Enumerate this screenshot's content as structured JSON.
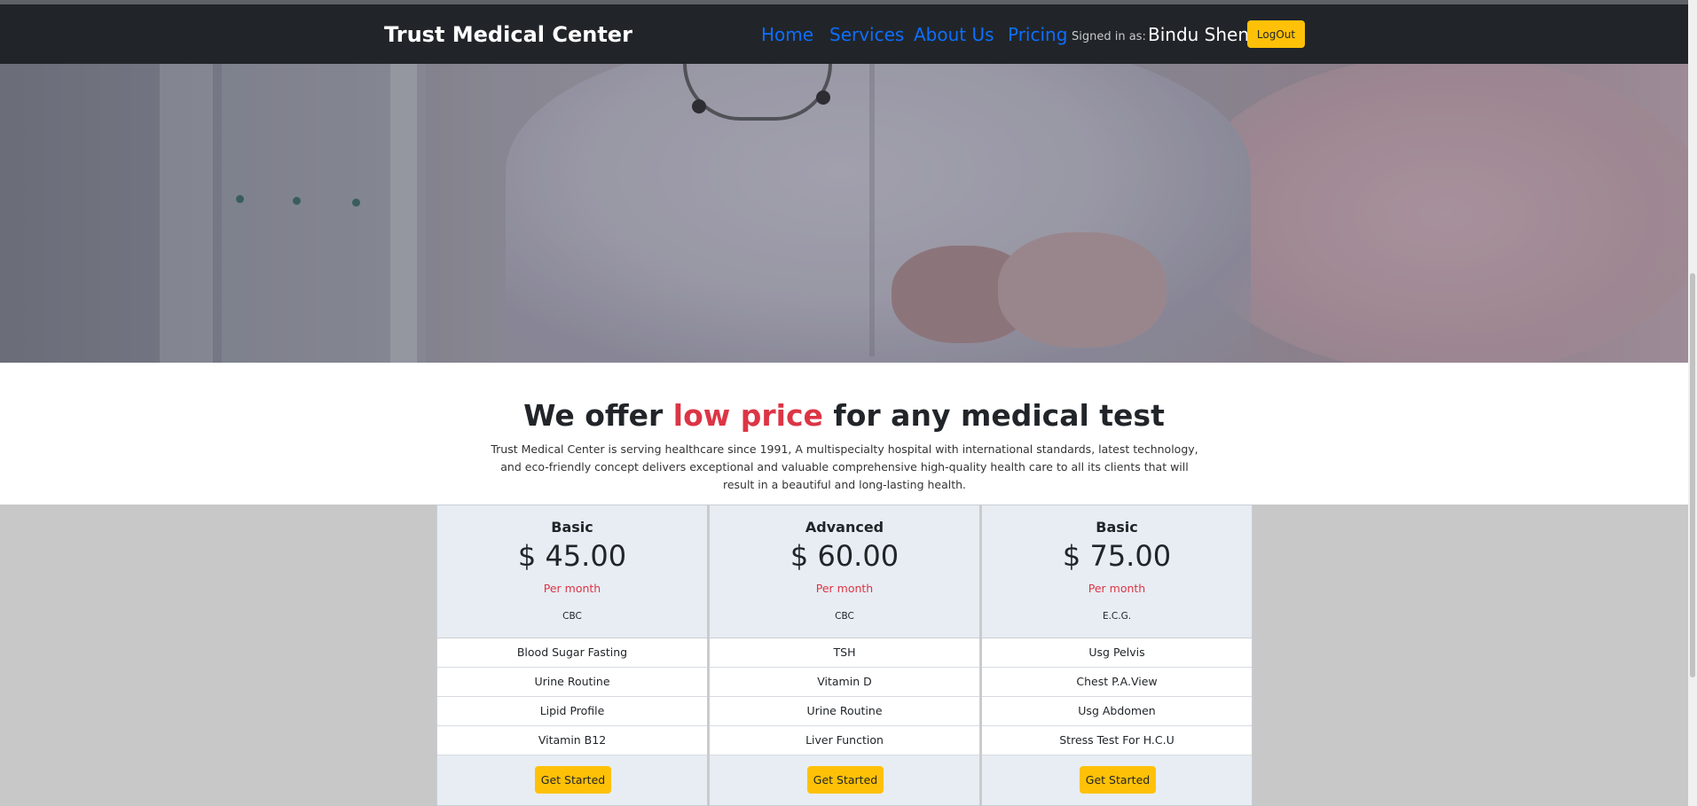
{
  "navbar": {
    "brand": "Trust Medical Center",
    "links": [
      "Home",
      "Services",
      "About Us",
      "Pricing"
    ],
    "signed_in_label": "Signed in as:",
    "user_name": "Bindu Shen",
    "logout_label": "LogOut"
  },
  "intro": {
    "headline_prefix": "We offer ",
    "headline_accent": "low price",
    "headline_suffix": " for any medical test",
    "description": "Trust Medical Center is serving healthcare since 1991, A multispecialty hospital with international standards, latest technology, and eco-friendly concept delivers exceptional and valuable comprehensive high-quality health care to all its clients that will result in a beautiful and long-lasting health."
  },
  "plans": [
    {
      "name": "Basic",
      "price": "$ 45.00",
      "period": "Per month",
      "first_test": "CBC",
      "tests": [
        "Blood Sugar Fasting",
        "Urine Routine",
        "Lipid Profile",
        "Vitamin B12"
      ],
      "button_label": "Get Started"
    },
    {
      "name": "Advanced",
      "price": "$ 60.00",
      "period": "Per month",
      "first_test": "CBC",
      "tests": [
        "TSH",
        "Vitamin D",
        "Urine Routine",
        "Liver Function"
      ],
      "button_label": "Get Started"
    },
    {
      "name": "Basic",
      "price": "$ 75.00",
      "period": "Per month",
      "first_test": "E.C.G.",
      "tests": [
        "Usg Pelvis",
        "Chest P.A.View",
        "Usg Abdomen",
        "Stress Test For H.C.U"
      ],
      "button_label": "Get Started"
    }
  ],
  "colors": {
    "navbar_bg": "#212529",
    "link": "#0d6efd",
    "accent_red": "#dc3545",
    "button_yellow": "#ffc107",
    "card_bg": "#e8edf3"
  }
}
